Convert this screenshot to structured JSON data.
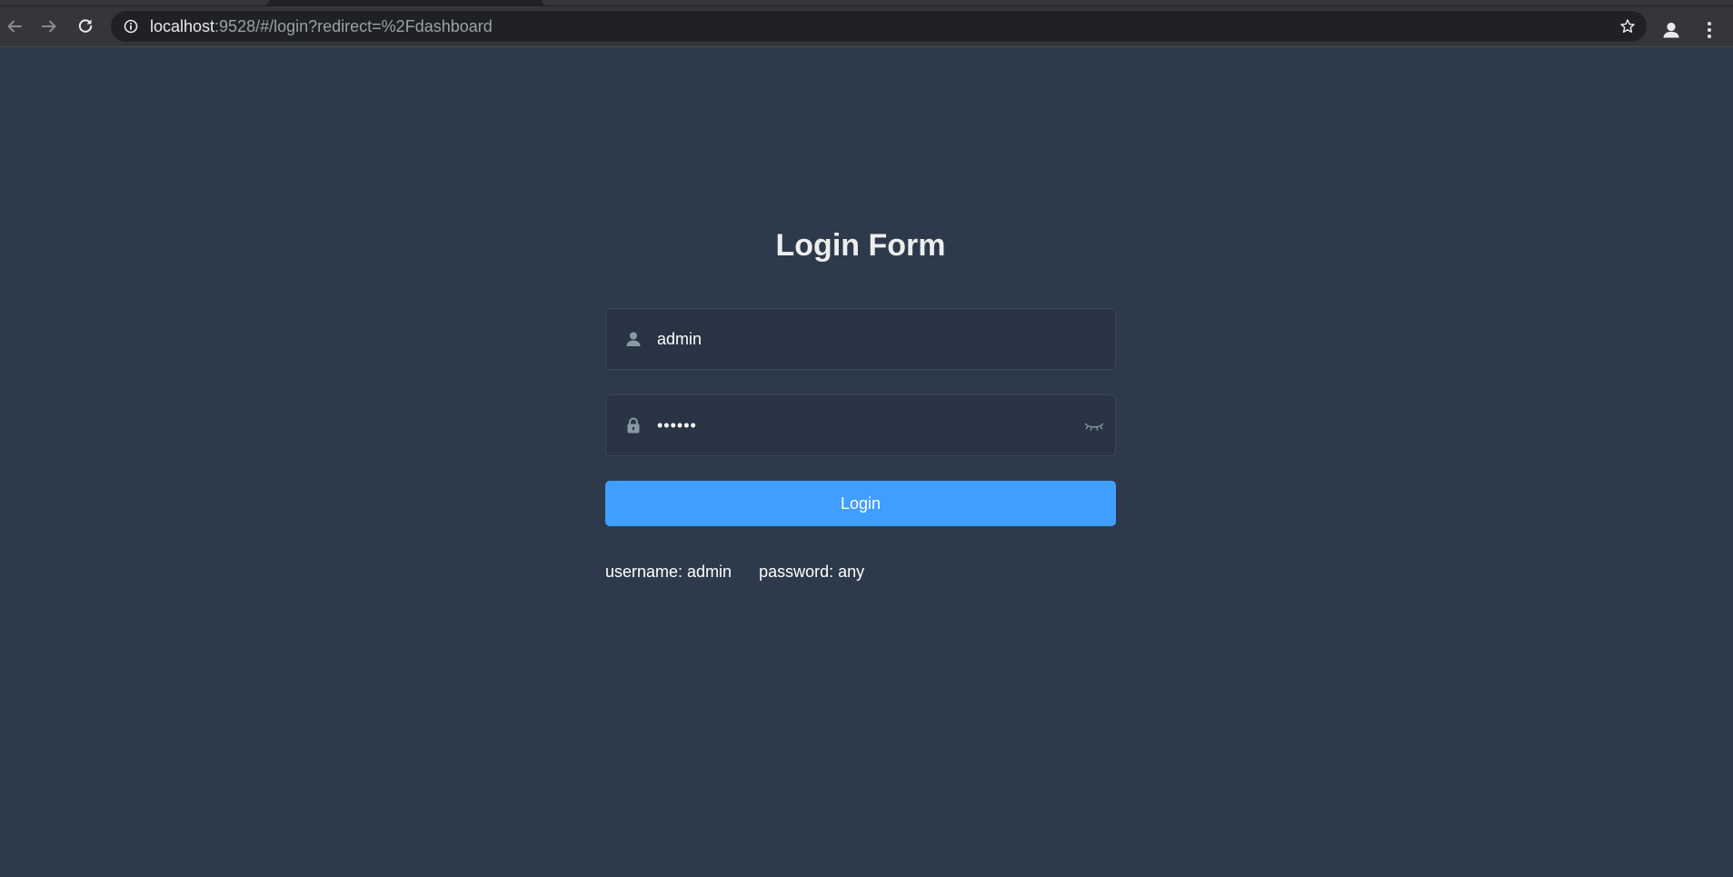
{
  "browser": {
    "url_host": "localhost",
    "url_rest": ":9528/#/login?redirect=%2Fdashboard",
    "icons": {
      "back": "arrow-left-icon",
      "forward": "arrow-right-icon",
      "reload": "reload-icon",
      "site_info": "info-icon",
      "bookmark": "star-icon",
      "profile": "person-icon",
      "menu": "kebab-menu-icon"
    }
  },
  "login": {
    "title": "Login Form",
    "username_value": "admin",
    "password_value": "admin1",
    "button_label": "Login",
    "tip_username": "username: admin",
    "tip_password": "password: any",
    "icons": {
      "username": "user-icon",
      "password": "lock-icon",
      "show_password": "eye-closed-icon"
    }
  },
  "colors": {
    "page_background": "#2d3a4b",
    "title": "#eeeeee",
    "button": "#409eff",
    "field_icon": "#889aa4"
  }
}
